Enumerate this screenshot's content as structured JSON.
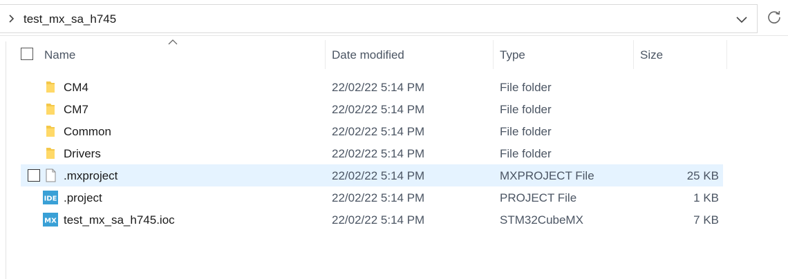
{
  "address_bar": {
    "path": "test_mx_sa_h745"
  },
  "columns": {
    "name": "Name",
    "date": "Date modified",
    "type": "Type",
    "size": "Size"
  },
  "colors": {
    "selected_row": "#e5f3ff",
    "folder": "#f4c84a",
    "app_icon": "#39a0d6"
  },
  "files": [
    {
      "name": "CM4",
      "date": "22/02/22 5:14 PM",
      "type": "File folder",
      "size": "",
      "icon": "folder-icon"
    },
    {
      "name": "CM7",
      "date": "22/02/22 5:14 PM",
      "type": "File folder",
      "size": "",
      "icon": "folder-icon"
    },
    {
      "name": "Common",
      "date": "22/02/22 5:14 PM",
      "type": "File folder",
      "size": "",
      "icon": "folder-icon"
    },
    {
      "name": "Drivers",
      "date": "22/02/22 5:14 PM",
      "type": "File folder",
      "size": "",
      "icon": "folder-icon"
    },
    {
      "name": ".mxproject",
      "date": "22/02/22 5:14 PM",
      "type": "MXPROJECT File",
      "size": "25 KB",
      "icon": "blank-file-icon",
      "selected": true
    },
    {
      "name": ".project",
      "date": "22/02/22 5:14 PM",
      "type": "PROJECT File",
      "size": "1 KB",
      "icon": "ide-file-icon",
      "icon_text": "IDE"
    },
    {
      "name": "test_mx_sa_h745.ioc",
      "date": "22/02/22 5:14 PM",
      "type": "STM32CubeMX",
      "size": "7 KB",
      "icon": "stm32cubemx-file-icon",
      "icon_text": "MX"
    }
  ]
}
